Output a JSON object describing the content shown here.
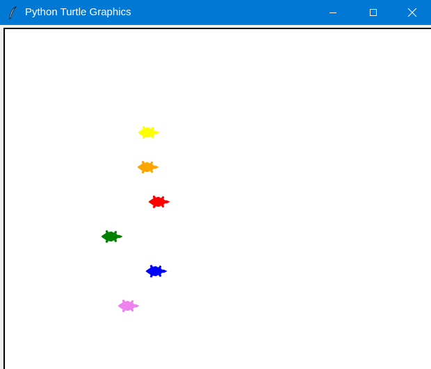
{
  "window": {
    "title": "Python Turtle Graphics",
    "titlebar_color": "#0078d4",
    "icons": {
      "app": "feather-icon",
      "minimize": "minimize-icon",
      "maximize": "maximize-icon",
      "close": "close-icon"
    }
  },
  "canvas": {
    "background": "#ffffff",
    "turtles": [
      {
        "color": "yellow",
        "fill": "#ffff00"
      },
      {
        "color": "orange",
        "fill": "#ffa500"
      },
      {
        "color": "red",
        "fill": "#ff0000"
      },
      {
        "color": "green",
        "fill": "#008000"
      },
      {
        "color": "blue",
        "fill": "#0000ff"
      },
      {
        "color": "violet",
        "fill": "#ee82ee"
      }
    ]
  }
}
